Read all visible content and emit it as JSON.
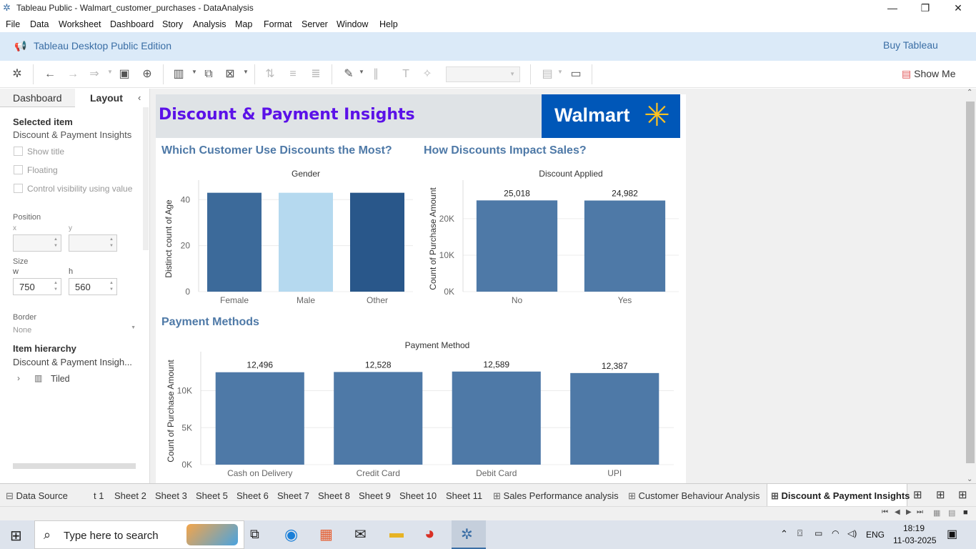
{
  "window": {
    "title": "Tableau Public - Walmart_customer_purchases - DataAnalysis"
  },
  "menu": [
    "File",
    "Data",
    "Worksheet",
    "Dashboard",
    "Story",
    "Analysis",
    "Map",
    "Format",
    "Server",
    "Window",
    "Help"
  ],
  "banner": {
    "edition": "Tableau Desktop Public Edition",
    "buy": "Buy Tableau"
  },
  "toolbar": {
    "show_me": "Show Me"
  },
  "left_pane": {
    "tabs": [
      "Dashboard",
      "Layout"
    ],
    "selected_item_heading": "Selected item",
    "selected_item": "Discount & Payment Insights",
    "checkboxes": [
      "Show title",
      "Floating",
      "Control visibility using value"
    ],
    "position_label": "Position",
    "x_label": "x",
    "y_label": "y",
    "size_label": "Size",
    "w_label": "w",
    "h_label": "h",
    "w_value": "750",
    "h_value": "560",
    "border_label": "Border",
    "border_value": "None",
    "hierarchy_heading": "Item hierarchy",
    "hierarchy_item": "Discount & Payment Insigh...",
    "tiled": "Tiled"
  },
  "dashboard": {
    "title": "Discount & Payment Insights",
    "logo_text": "Walmart",
    "section1": "Which Customer Use Discounts the Most?",
    "section2": "How Discounts Impact Sales?",
    "section3": "Payment Methods"
  },
  "chart_data": [
    {
      "type": "bar",
      "title": "Gender",
      "categories": [
        "Female",
        "Male",
        "Other"
      ],
      "values": [
        43,
        43,
        43
      ],
      "colors": [
        "#3c6a9a",
        "#b5d9ef",
        "#29578a"
      ],
      "ylabel": "Distinct count of Age",
      "yticks": [
        "0",
        "20",
        "40"
      ],
      "ylim": [
        0,
        46
      ]
    },
    {
      "type": "bar",
      "title": "Discount Applied",
      "categories": [
        "No",
        "Yes"
      ],
      "values": [
        25018,
        24982
      ],
      "labels": [
        "25,018",
        "24,982"
      ],
      "colors": [
        "#4e79a7",
        "#4e79a7"
      ],
      "ylabel": "Count of Purchase Amount",
      "yticks": [
        "0K",
        "10K",
        "20K"
      ],
      "ylim": [
        0,
        29000
      ]
    },
    {
      "type": "bar",
      "title": "Payment Method",
      "categories": [
        "Cash on Delivery",
        "Credit Card",
        "Debit Card",
        "UPI"
      ],
      "values": [
        12496,
        12528,
        12589,
        12387
      ],
      "labels": [
        "12,496",
        "12,528",
        "12,589",
        "12,387"
      ],
      "colors": [
        "#4e79a7",
        "#4e79a7",
        "#4e79a7",
        "#4e79a7"
      ],
      "ylabel": "Count of Purchase Amount",
      "yticks": [
        "0K",
        "5K",
        "10K"
      ],
      "ylim": [
        0,
        14500
      ]
    }
  ],
  "sheets": [
    "Data Source",
    "t 1",
    "Sheet 2",
    "Sheet 3",
    "Sheet 5",
    "Sheet 6",
    "Sheet 7",
    "Sheet 8",
    "Sheet 9",
    "Sheet 10",
    "Sheet 11",
    "Sales Performance analysis",
    "Customer Behaviour Analysis",
    "Discount & Payment Insights"
  ],
  "taskbar": {
    "search_placeholder": "Type here to search",
    "lang": "ENG",
    "time": "18:19",
    "date": "11-03-2025"
  }
}
